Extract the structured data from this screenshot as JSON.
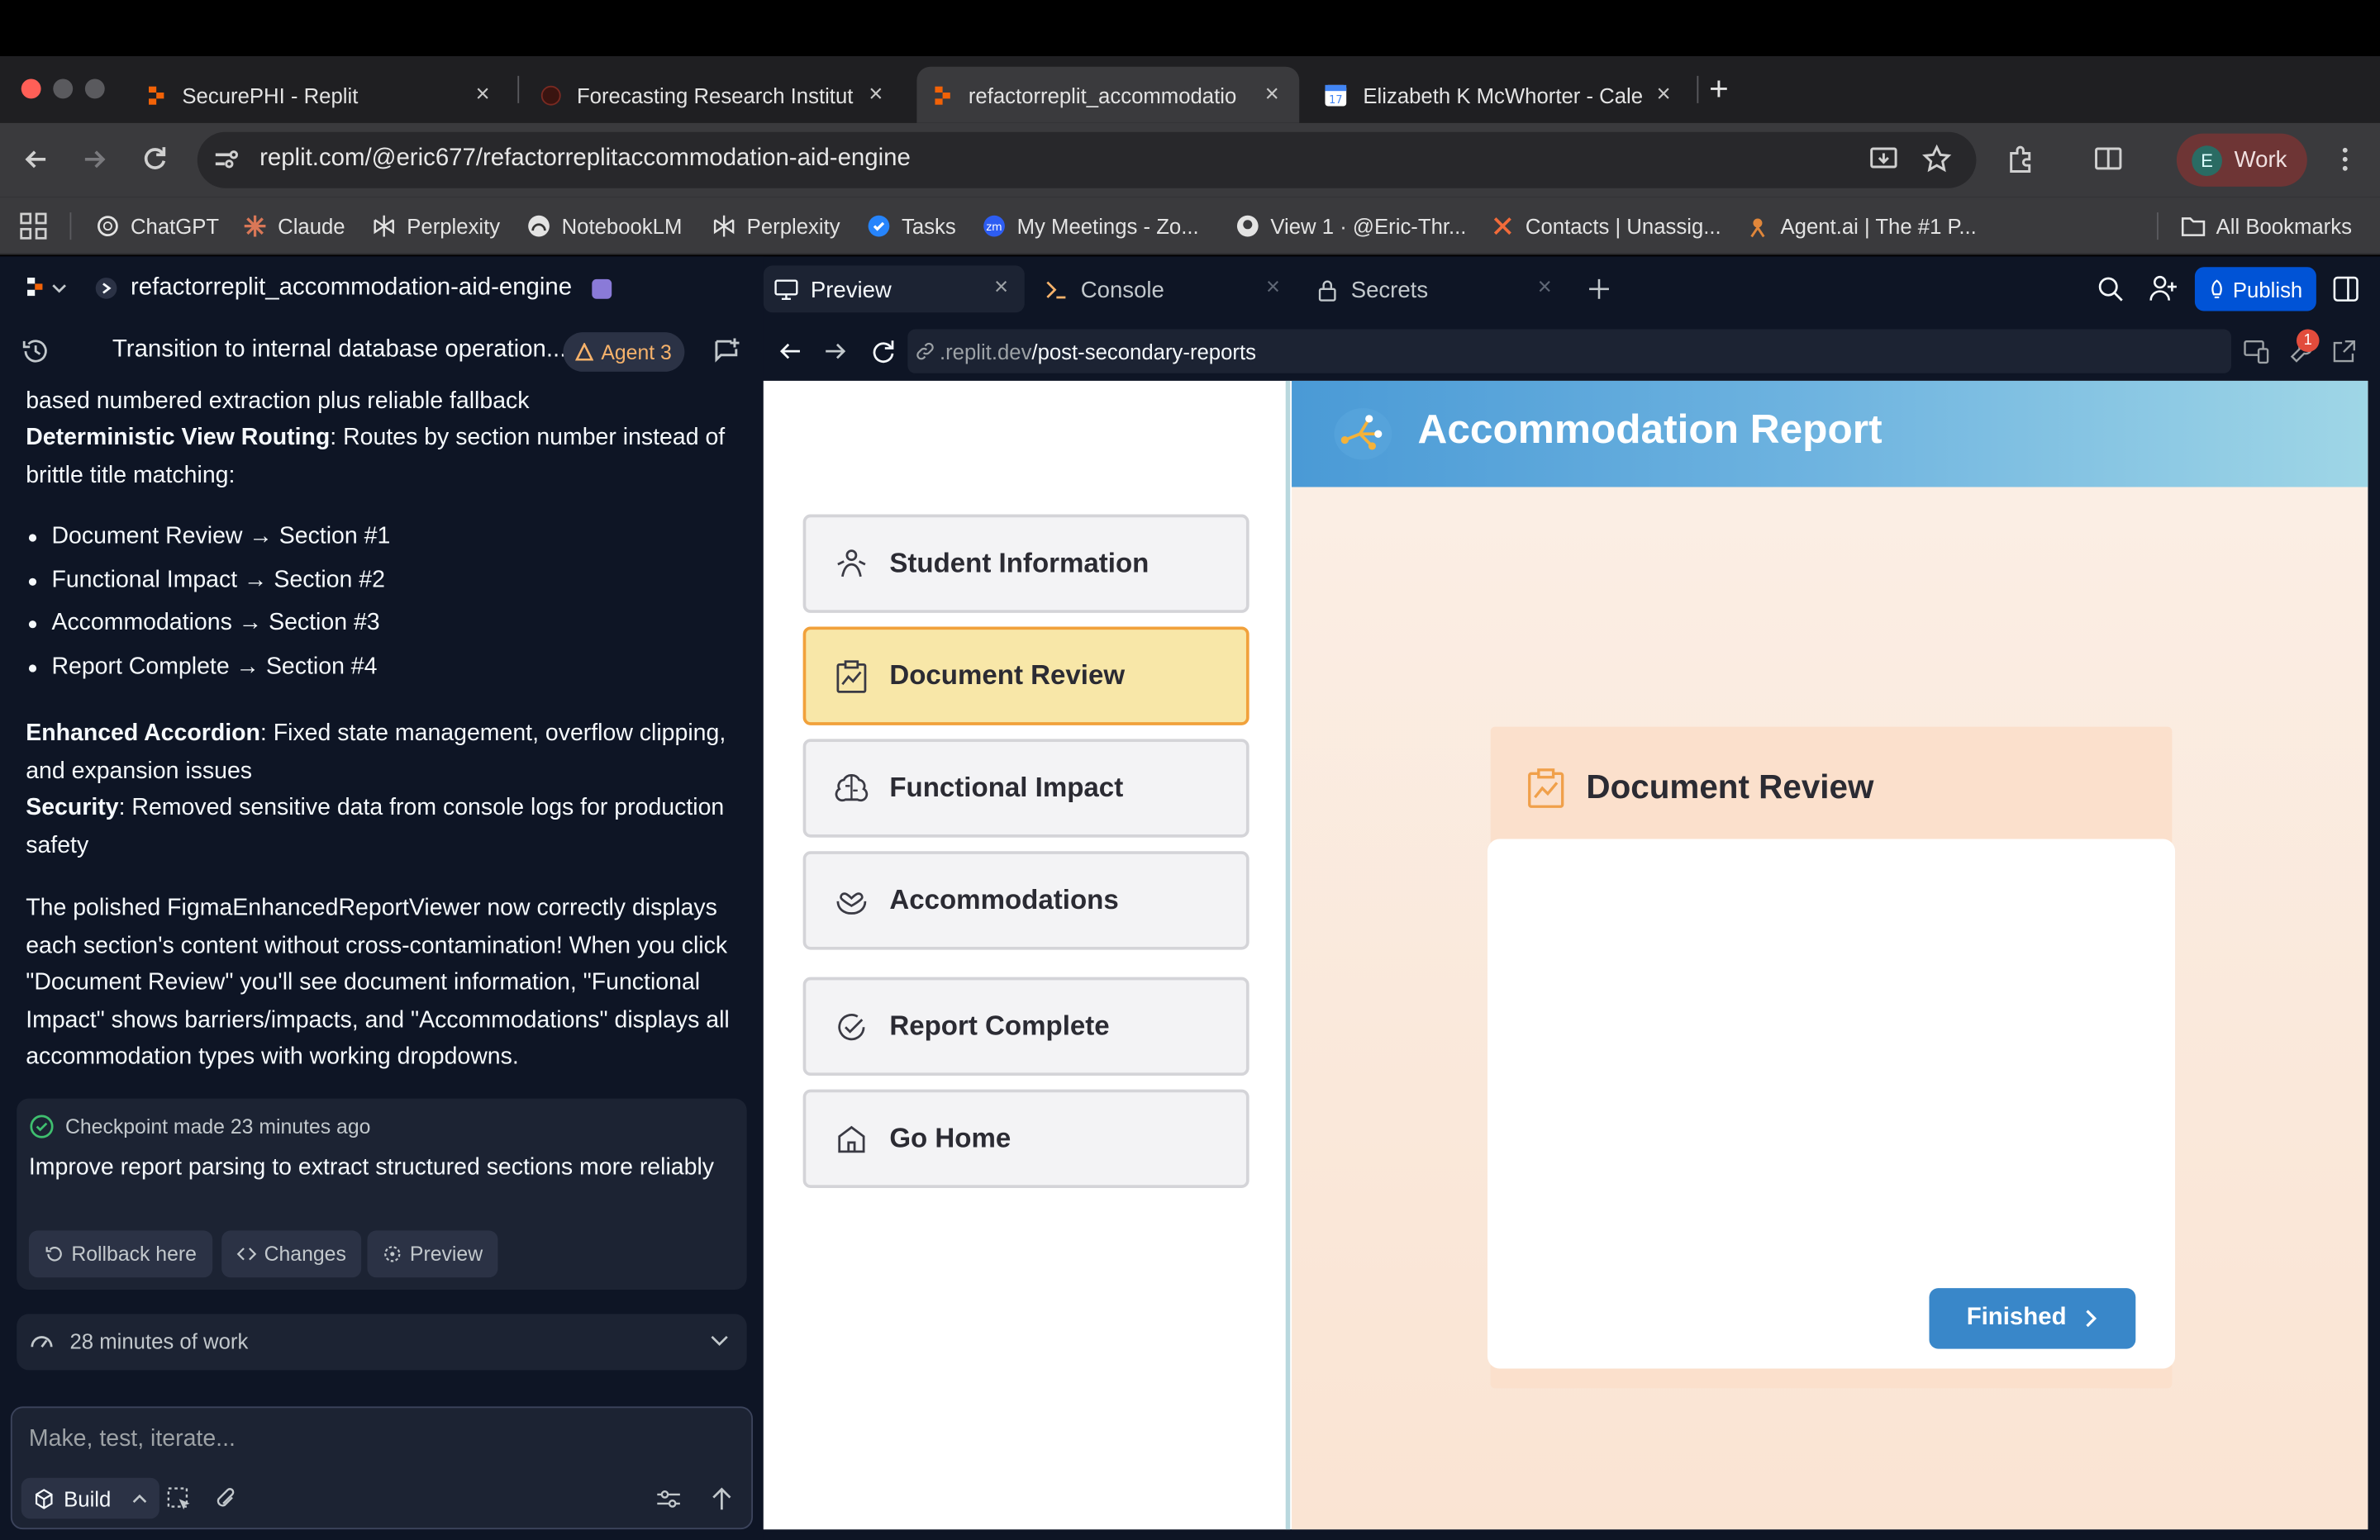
{
  "browser": {
    "tabs": [
      {
        "title": "SecurePHI - Replit"
      },
      {
        "title": "Forecasting Research Institut"
      },
      {
        "title": "refactorreplit_accommodatio"
      },
      {
        "title": "Elizabeth K McWhorter - Cale"
      }
    ],
    "new_tab": "+",
    "url": "replit.com/@eric677/refactorreplitaccommodation-aid-engine",
    "profile": {
      "initial": "E",
      "label": "Work"
    },
    "bookmarks": [
      "ChatGPT",
      "Claude",
      "Perplexity",
      "NotebookLM",
      "Perplexity",
      "Tasks",
      "My Meetings - Zo...",
      "View 1 · @Eric-Thr...",
      "Contacts | Unassig...",
      "Agent.ai | The #1 P..."
    ],
    "all_bookmarks": "All Bookmarks"
  },
  "replit": {
    "project_name": "refactorreplit_accommodation-aid-engine",
    "thread_title": "Transition to internal database operation...",
    "agent_badge": "Agent 3",
    "workspace_tabs": [
      {
        "label": "Preview"
      },
      {
        "label": "Console"
      },
      {
        "label": "Secrets"
      }
    ],
    "publish": "Publish",
    "preview_url": {
      "prefix": ".replit.dev",
      "path": "/post-secondary-reports"
    },
    "notification_count": "1"
  },
  "chat": {
    "line_partial": "based numbered extraction plus reliable fallback",
    "routing_bold": "Deterministic View Routing",
    "routing_text": ": Routes by section number instead of brittle title matching:",
    "bullets": [
      "Document Review → Section #1",
      "Functional Impact → Section #2",
      "Accommodations → Section #3",
      "Report Complete → Section #4"
    ],
    "accordion_bold": "Enhanced Accordion",
    "accordion_text": ": Fixed state management, overflow clipping, and expansion issues",
    "security_bold": "Security",
    "security_text": ": Removed sensitive data from console logs for production safety",
    "summary": "The polished FigmaEnhancedReportViewer now correctly displays each section's content without cross-contamination! When you click \"Document Review\" you'll see document information, \"Functional Impact\" shows barriers/impacts, and \"Accommodations\" displays all accommodation types with working dropdowns.",
    "checkpoint": {
      "label": "Checkpoint made",
      "time": "23 minutes ago",
      "message": "Improve report parsing to extract structured sections more reliably",
      "actions": [
        "Rollback here",
        "Changes",
        "Preview"
      ]
    },
    "work_summary": "28 minutes of work",
    "input_placeholder": "Make, test, iterate...",
    "build_label": "Build"
  },
  "report": {
    "title": "Accommodation Report",
    "nav": [
      {
        "label": "Student Information",
        "icon": "student-icon",
        "selected": false
      },
      {
        "label": "Document Review",
        "icon": "clipboard-chart-icon",
        "selected": true
      },
      {
        "label": "Functional Impact",
        "icon": "brain-icon",
        "selected": false
      },
      {
        "label": "Accommodations",
        "icon": "hands-heart-icon",
        "selected": false
      },
      {
        "label": "Report Complete",
        "icon": "check-circle-icon",
        "selected": false
      },
      {
        "label": "Go Home",
        "icon": "home-icon",
        "selected": false
      }
    ],
    "section_title": "Document Review",
    "finished_label": "Finished"
  },
  "colors": {
    "accent_blue": "#3987c9",
    "selected_nav": "#f8e7a8",
    "selected_border": "#f1a13b",
    "publish": "#0053d6"
  }
}
